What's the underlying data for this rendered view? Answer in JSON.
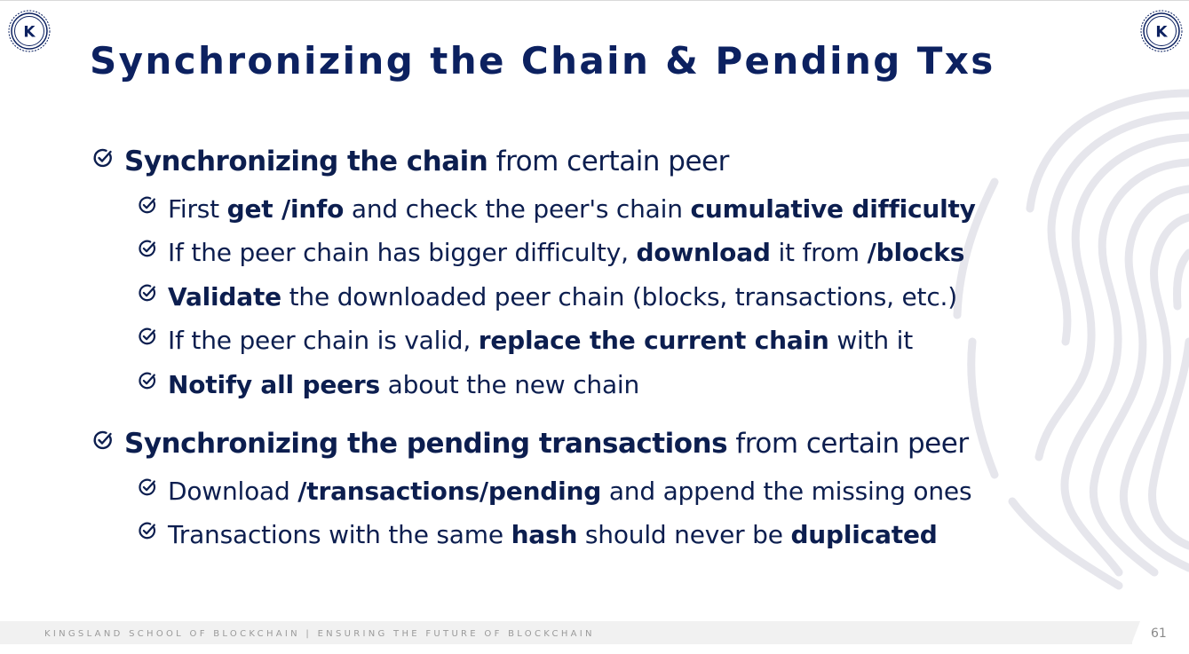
{
  "slide": {
    "title": "Synchronizing the Chain & Pending Txs",
    "logo_letter": "K",
    "page_number": "61",
    "footer": "KINGSLAND SCHOOL OF BLOCKCHAIN | ENSURING THE FUTURE OF BLOCKCHAIN"
  },
  "bullets": [
    {
      "level": 1,
      "segments": [
        {
          "text": "Synchronizing the chain",
          "bold": true
        },
        {
          "text": " from certain peer",
          "bold": false
        }
      ]
    },
    {
      "level": 2,
      "segments": [
        {
          "text": "First ",
          "bold": false
        },
        {
          "text": "get /info",
          "bold": true
        },
        {
          "text": " and check the peer's chain ",
          "bold": false
        },
        {
          "text": "cumulative difficulty",
          "bold": true
        }
      ]
    },
    {
      "level": 2,
      "segments": [
        {
          "text": "If the peer chain has bigger difficulty, ",
          "bold": false
        },
        {
          "text": "download",
          "bold": true
        },
        {
          "text": " it from ",
          "bold": false
        },
        {
          "text": "/blocks",
          "bold": true
        }
      ]
    },
    {
      "level": 2,
      "segments": [
        {
          "text": "Validate",
          "bold": true
        },
        {
          "text": " the downloaded peer chain (blocks, transactions, etc.)",
          "bold": false
        }
      ]
    },
    {
      "level": 2,
      "segments": [
        {
          "text": "If the peer chain is valid, ",
          "bold": false
        },
        {
          "text": "replace the current chain",
          "bold": true
        },
        {
          "text": " with it",
          "bold": false
        }
      ]
    },
    {
      "level": 2,
      "segments": [
        {
          "text": "Notify all peers",
          "bold": true
        },
        {
          "text": " about the new chain",
          "bold": false
        }
      ]
    },
    {
      "level": 1,
      "segments": [
        {
          "text": "Synchronizing the pending transactions",
          "bold": true
        },
        {
          "text": " from certain peer",
          "bold": false
        }
      ]
    },
    {
      "level": 2,
      "segments": [
        {
          "text": "Download ",
          "bold": false
        },
        {
          "text": "/transactions/pending",
          "bold": true
        },
        {
          "text": " and append the missing ones",
          "bold": false
        }
      ]
    },
    {
      "level": 2,
      "segments": [
        {
          "text": "Transactions with the same ",
          "bold": false
        },
        {
          "text": "hash",
          "bold": true
        },
        {
          "text": " should never be ",
          "bold": false
        },
        {
          "text": "duplicated",
          "bold": true
        }
      ]
    }
  ],
  "icons": {
    "bullet": "check-circle-icon",
    "logo": "kingsland-logo-icon"
  },
  "colors": {
    "title": "#0c2160",
    "text": "#0c1e4f",
    "footer_text": "#9a9a9a",
    "footer_bar": "#f1f1f1"
  }
}
